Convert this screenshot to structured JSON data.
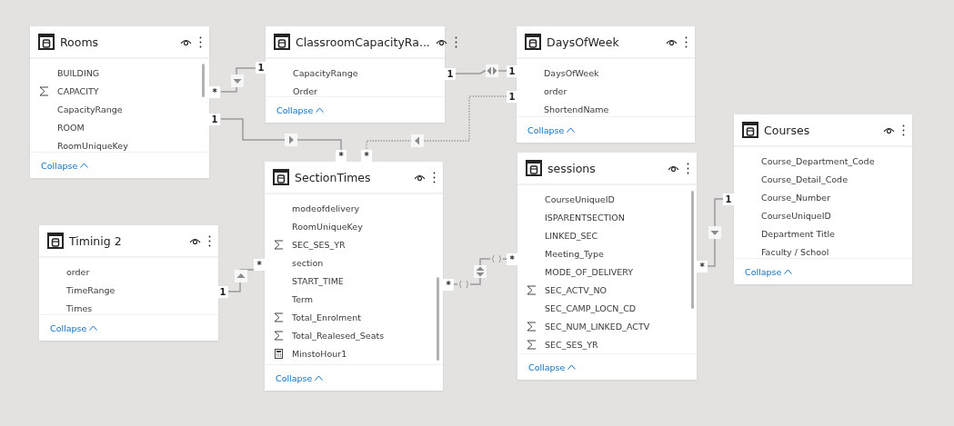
{
  "tables": [
    {
      "name": "Rooms",
      "fields": [
        {
          "name": "BUILDING",
          "kind": "column"
        },
        {
          "name": "CAPACITY",
          "kind": "sum"
        },
        {
          "name": "CapacityRange",
          "kind": "column"
        },
        {
          "name": "ROOM",
          "kind": "column"
        },
        {
          "name": "RoomUniqueKey",
          "kind": "column"
        }
      ],
      "collapse": "Collapse"
    },
    {
      "name": "ClassroomCapacityRa...",
      "fields": [
        {
          "name": "CapacityRange",
          "kind": "column"
        },
        {
          "name": "Order",
          "kind": "column"
        }
      ],
      "collapse": "Collapse"
    },
    {
      "name": "DaysOfWeek",
      "fields": [
        {
          "name": "DaysOfWeek",
          "kind": "column"
        },
        {
          "name": "order",
          "kind": "column"
        },
        {
          "name": "ShortendName",
          "kind": "column"
        }
      ],
      "collapse": "Collapse"
    },
    {
      "name": "Courses",
      "fields": [
        {
          "name": "Course_Department_Code",
          "kind": "column"
        },
        {
          "name": "Course_Detail_Code",
          "kind": "column"
        },
        {
          "name": "Course_Number",
          "kind": "column"
        },
        {
          "name": "CourseUniqueID",
          "kind": "column"
        },
        {
          "name": "Department Title",
          "kind": "column"
        },
        {
          "name": "Faculty / School",
          "kind": "column"
        }
      ],
      "collapse": "Collapse"
    },
    {
      "name": "SectionTimes",
      "fields": [
        {
          "name": "modeofdelivery",
          "kind": "column"
        },
        {
          "name": "RoomUniqueKey",
          "kind": "column"
        },
        {
          "name": "SEC_SES_YR",
          "kind": "sum"
        },
        {
          "name": "section",
          "kind": "column"
        },
        {
          "name": "START_TIME",
          "kind": "column"
        },
        {
          "name": "Term",
          "kind": "column"
        },
        {
          "name": "Total_Enrolment",
          "kind": "sum"
        },
        {
          "name": "Total_Realesed_Seats",
          "kind": "sum"
        },
        {
          "name": "MinstoHour1",
          "kind": "calc"
        }
      ],
      "collapse": "Collapse"
    },
    {
      "name": "sessions",
      "fields": [
        {
          "name": "CourseUniqueID",
          "kind": "column"
        },
        {
          "name": "ISPARENTSECTION",
          "kind": "column"
        },
        {
          "name": "LINKED_SEC",
          "kind": "column"
        },
        {
          "name": "Meeting_Type",
          "kind": "column"
        },
        {
          "name": "MODE_OF_DELIVERY",
          "kind": "column"
        },
        {
          "name": "SEC_ACTV_NO",
          "kind": "sum"
        },
        {
          "name": "SEC_CAMP_LOCN_CD",
          "kind": "column"
        },
        {
          "name": "SEC_NUM_LINKED_ACTV",
          "kind": "sum"
        },
        {
          "name": "SEC_SES_YR",
          "kind": "sum"
        }
      ],
      "collapse": "Collapse"
    },
    {
      "name": "Timinig 2",
      "fields": [
        {
          "name": "order",
          "kind": "column"
        },
        {
          "name": "TimeRange",
          "kind": "column"
        },
        {
          "name": "Times",
          "kind": "column"
        }
      ],
      "collapse": "Collapse"
    }
  ],
  "relationships": [
    {
      "from_label": "*",
      "to_label": "1",
      "active": true,
      "kind": "single"
    },
    {
      "from_label": "1",
      "to_label": "*",
      "active": true,
      "kind": "single"
    },
    {
      "from_label": "1",
      "to_label": "1",
      "active": true,
      "kind": "both"
    },
    {
      "from_label": "1",
      "to_label": "*",
      "active": false,
      "kind": "single"
    },
    {
      "from_label": "1",
      "to_label": "*",
      "active": true,
      "kind": "single"
    },
    {
      "from_label": "*",
      "to_label": "*",
      "active": true,
      "kind": "limited"
    },
    {
      "from_label": "*",
      "to_label": "1",
      "active": true,
      "kind": "single"
    }
  ]
}
